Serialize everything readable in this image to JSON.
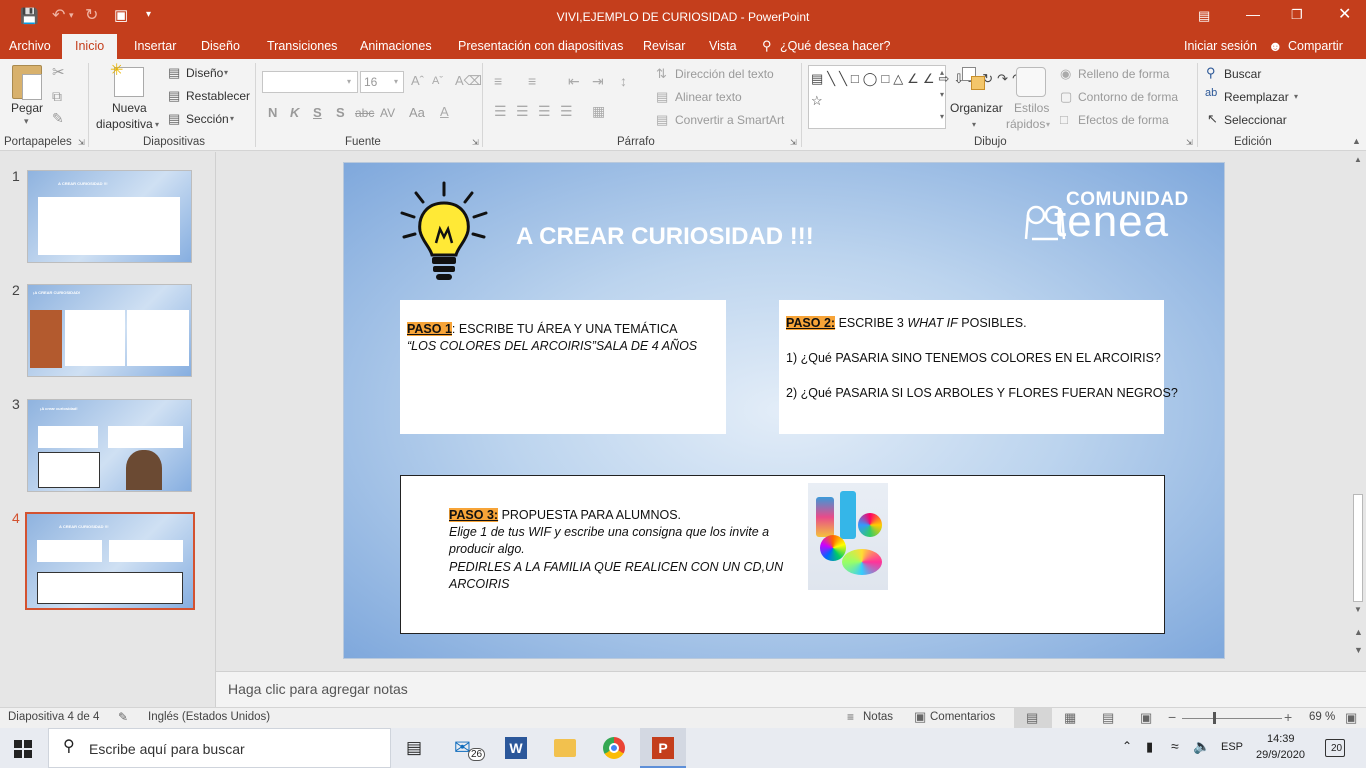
{
  "titlebar": {
    "title": "VIVI,EJEMPLO DE CURIOSIDAD  -  PowerPoint",
    "icons": [
      "save-icon",
      "undo-icon",
      "redo-icon",
      "present-icon",
      "customize-icon"
    ]
  },
  "menu": {
    "tabs": [
      "Archivo",
      "Inicio",
      "Insertar",
      "Diseño",
      "Transiciones",
      "Animaciones",
      "Presentación con diapositivas",
      "Revisar",
      "Vista"
    ],
    "tell_me": "¿Qué desea hacer?",
    "sign_in": "Iniciar sesión",
    "share": "Compartir"
  },
  "ribbon": {
    "portapapeles": {
      "paste": "Pegar",
      "label": "Portapapeles"
    },
    "diapositivas": {
      "new_slide": "Nueva",
      "new_slide2": "diapositiva",
      "layout": "Diseño",
      "reset": "Restablecer",
      "section": "Sección",
      "label": "Diapositivas"
    },
    "fuente": {
      "font_name": "",
      "font_size": "16",
      "bold": "N",
      "italic": "K",
      "underline": "S",
      "strike": "S",
      "shadow": "abc",
      "spacing": "AV",
      "case": "Aa",
      "label": "Fuente"
    },
    "parrafo": {
      "direction": "Dirección del texto",
      "align_text": "Alinear texto",
      "smartart": "Convertir a SmartArt",
      "label": "Párrafo"
    },
    "dibujo": {
      "arrange": "Organizar",
      "styles": "Estilos",
      "styles2": "rápidos",
      "fill": "Relleno de forma",
      "outline": "Contorno de forma",
      "effects": "Efectos de forma",
      "label": "Dibujo"
    },
    "edicion": {
      "find": "Buscar",
      "replace": "Reemplazar",
      "select": "Seleccionar",
      "label": "Edición"
    }
  },
  "thumbnails": [
    {
      "num": "1",
      "title": "A CREAR CURIOSIDAD !!!"
    },
    {
      "num": "2",
      "title": "¡A CREAR CURIOSIDAD!"
    },
    {
      "num": "3",
      "title": "¡A crear curiosidad!"
    },
    {
      "num": "4",
      "title": "A CREAR CURIOSIDAD !!!",
      "selected": true
    }
  ],
  "slide": {
    "title": "A CREAR CURIOSIDAD !!!",
    "brand_top": "COMUNIDAD",
    "brand_bottom": "tenea",
    "paso1_label": "PASO 1",
    "paso1_rest": ": ESCRIBE TU ÁREA Y UNA TEMÁTICA",
    "paso1_line2": "“LOS COLORES DEL ARCOIRIS”SALA DE 4 AÑOS",
    "paso2_label": "PASO 2:",
    "paso2_rest_a": " ESCRIBE 3 ",
    "paso2_italic": "WHAT IF",
    "paso2_rest_b": " POSIBLES.",
    "paso2_q1": "1) ¿Qué PASARIA SINO TENEMOS COLORES EN EL ARCOIRIS?",
    "paso2_q2": "2) ¿Qué PASARIA SI LOS ARBOLES Y FLORES FUERAN NEGROS?",
    "paso3_label": "PASO 3:",
    "paso3_rest": " PROPUESTA PARA ALUMNOS.",
    "paso3_line2": "Elige 1 de tus WIF y escribe una consigna que los invite a producir algo.",
    "paso3_line3": "PEDIRLES A LA FAMILIA QUE REALICEN CON UN CD,UN ARCOIRIS"
  },
  "notes": {
    "placeholder": "Haga clic para agregar notas"
  },
  "status": {
    "slide_info": "Diapositiva 4 de 4",
    "language": "Inglés (Estados Unidos)",
    "notes": "Notas",
    "comments": "Comentarios",
    "zoom": "69 %"
  },
  "taskbar": {
    "search_placeholder": "Escribe aquí para buscar",
    "mail_badge": "26",
    "lang": "ESP",
    "time": "14:39",
    "date": "29/9/2020",
    "notif_count": "20"
  }
}
